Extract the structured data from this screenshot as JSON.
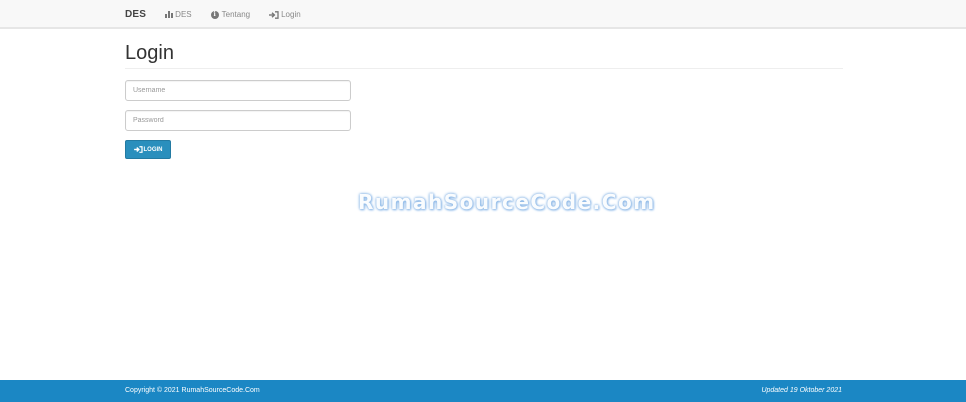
{
  "navbar": {
    "brand": "DES",
    "items": [
      {
        "label": "DES",
        "icon": "bar-chart-icon"
      },
      {
        "label": "Tentang",
        "icon": "info-icon"
      },
      {
        "label": "Login",
        "icon": "sign-in-icon"
      }
    ]
  },
  "main": {
    "title": "Login",
    "username_placeholder": "Username",
    "password_placeholder": "Password",
    "login_button": "LOGIN"
  },
  "watermark": "RumahSourceCode.Com",
  "footer": {
    "copyright": "Copyright © 2021 RumahSourceCode.Com",
    "updated": "Updated 19 Oktober 2021"
  },
  "colors": {
    "accent": "#2a8fbd",
    "footer": "#1b87c4",
    "navbar_bg": "#f8f8f8"
  }
}
